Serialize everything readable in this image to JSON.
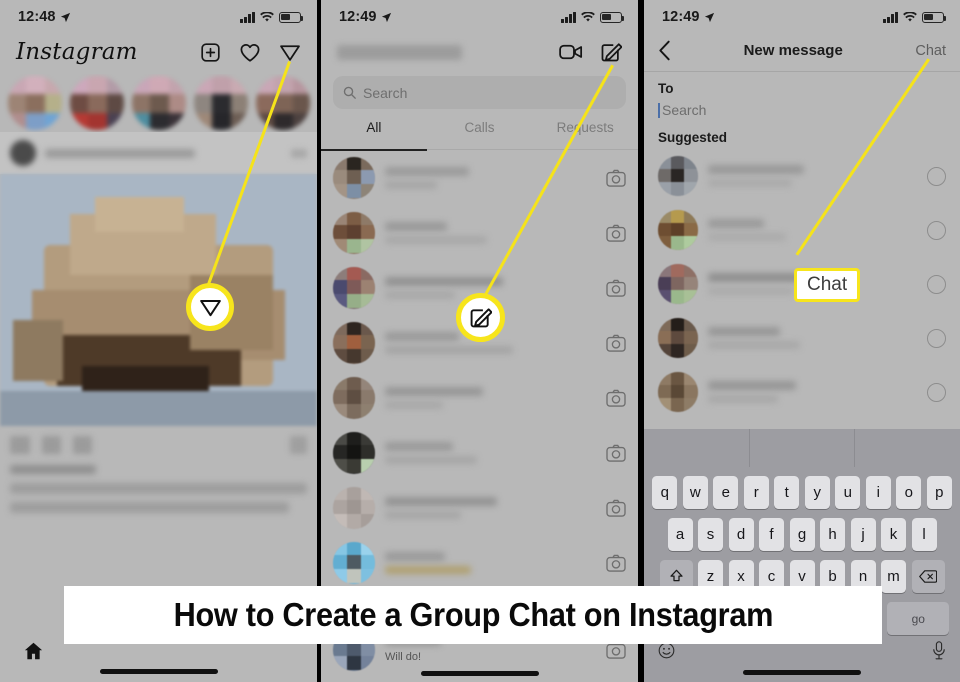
{
  "meta": {
    "banner_title": "How to Create a Group Chat on Instagram",
    "accent_yellow": "#f7e51c",
    "screen_bg": "#b8b8b8"
  },
  "panels": {
    "left": {
      "name": "instagram-feed",
      "status_bar": {
        "time": "12:48",
        "location_icon": "location-arrow-icon",
        "signal_icon": "cellular-signal-icon",
        "wifi_icon": "wifi-icon",
        "battery_icon": "battery-icon"
      },
      "header": {
        "logo": "Instagram",
        "icons": [
          "plus-square-icon",
          "heart-icon",
          "share-paper-plane-icon"
        ]
      },
      "stories_count": 5,
      "bottom_nav": {
        "home_icon": "home-icon"
      },
      "callout": {
        "icon": "share-paper-plane-icon",
        "type": "circle-highlight"
      }
    },
    "middle": {
      "name": "direct-messages-inbox",
      "status_bar": {
        "time": "12:49"
      },
      "header": {
        "username_blurred": true,
        "icons": [
          "video-camera-icon",
          "compose-pencil-icon"
        ]
      },
      "search": {
        "placeholder": "Search",
        "icon": "search-icon"
      },
      "tabs": [
        {
          "label": "All",
          "active": true
        },
        {
          "label": "Calls",
          "active": false
        },
        {
          "label": "Requests",
          "active": false
        }
      ],
      "conversations_count": 9,
      "row_icon": "camera-icon",
      "last_row_preview": "Will do!",
      "callout": {
        "icon": "compose-pencil-icon",
        "type": "circle-highlight"
      }
    },
    "right": {
      "name": "new-message-screen",
      "status_bar": {
        "time": "12:49"
      },
      "header": {
        "back_icon": "chevron-left-icon",
        "title": "New message",
        "action": "Chat"
      },
      "to_label": "To",
      "to_placeholder": "Search",
      "suggested_label": "Suggested",
      "suggested_count": 5,
      "row_control": "radio-circle-unchecked",
      "callout": {
        "label": "Chat",
        "type": "box-highlight"
      },
      "keyboard": {
        "row1": [
          "q",
          "w",
          "e",
          "r",
          "t",
          "y",
          "u",
          "i",
          "o",
          "p"
        ],
        "row2": [
          "a",
          "s",
          "d",
          "f",
          "g",
          "h",
          "j",
          "k",
          "l"
        ],
        "row3": [
          "z",
          "x",
          "c",
          "v",
          "b",
          "n",
          "m"
        ],
        "shift_icon": "shift-arrow-icon",
        "backspace_icon": "backspace-icon",
        "go_label": "go",
        "emoji_icon": "emoji-smiley-icon",
        "mic_icon": "microphone-icon"
      }
    }
  }
}
